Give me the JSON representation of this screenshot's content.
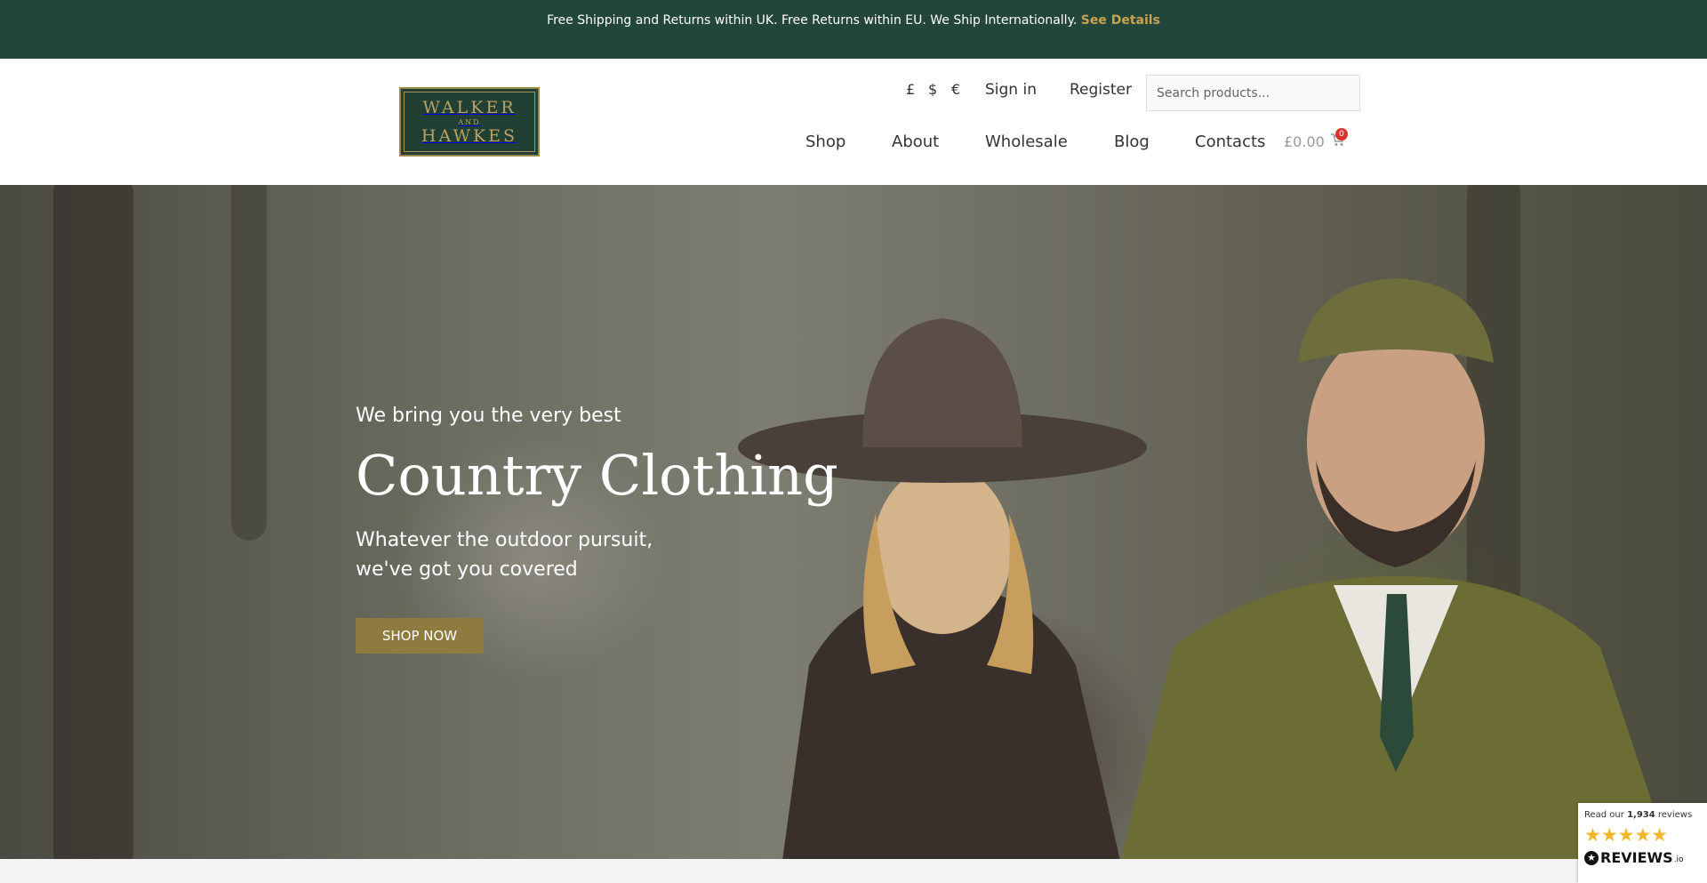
{
  "announcement": {
    "text": "Free Shipping and Returns within UK. Free Returns within EU. We Ship Internationally.",
    "link": "See Details"
  },
  "logo": {
    "top": "WALKER",
    "middle": "AND",
    "bottom": "HAWKES"
  },
  "header": {
    "currencies": [
      "£",
      "$",
      "€"
    ],
    "sign_in": "Sign in",
    "register": "Register",
    "search_placeholder": "Search products..."
  },
  "nav": {
    "items": [
      "Shop",
      "About",
      "Wholesale",
      "Blog",
      "Contacts"
    ],
    "cart_total": "£0.00",
    "cart_count": "0",
    "cart_icon": "shopping-cart-icon"
  },
  "hero": {
    "subtitle": "We bring you the very best",
    "title": "Country Clothing",
    "description_line1": "Whatever the outdoor pursuit,",
    "description_line2": "we've got you covered",
    "cta": "SHOP NOW"
  },
  "reviews": {
    "prefix": "Read our",
    "count": "1,934",
    "suffix": "reviews",
    "stars": "★★★★★",
    "brand": "REVIEWS",
    "brand_suffix": ".io",
    "star_color": "#f0b72b"
  },
  "colors": {
    "announcement_bg": "#22463c",
    "link_gold": "#c9a24e",
    "button_bg": "#8f7a3f",
    "logo_bg": "#213f33"
  }
}
